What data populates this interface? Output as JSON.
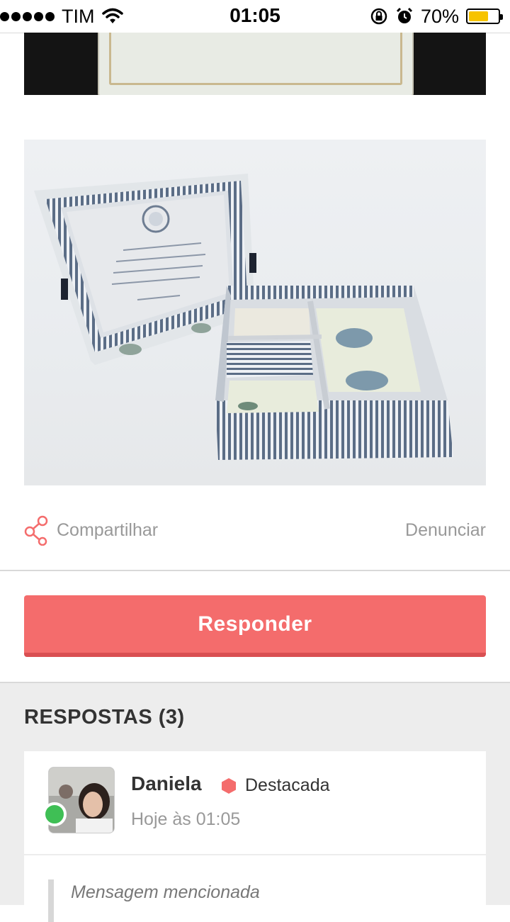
{
  "status_bar": {
    "carrier": "TIM",
    "time": "01:05",
    "battery": "70%",
    "battery_level": 0.7,
    "icons": [
      "signal-dots-icon",
      "wifi-icon",
      "rotation-lock-icon",
      "alarm-icon",
      "battery-icon"
    ]
  },
  "post": {
    "share_label": "Compartilhar",
    "report_label": "Denunciar"
  },
  "reply_button": {
    "label": "Responder"
  },
  "answers": {
    "title": "RESPOSTAS (3)",
    "items": [
      {
        "author": "Daniela",
        "badge": "Destacada",
        "timestamp": "Hoje às 01:05",
        "quoted_label": "Mensagem mencionada"
      }
    ]
  },
  "colors": {
    "accent": "#f46c6c",
    "accent_dark": "#d94f52",
    "online": "#3fbf55",
    "battery": "#f7c300",
    "muted_text": "#999999",
    "section_bg": "#ededed"
  }
}
